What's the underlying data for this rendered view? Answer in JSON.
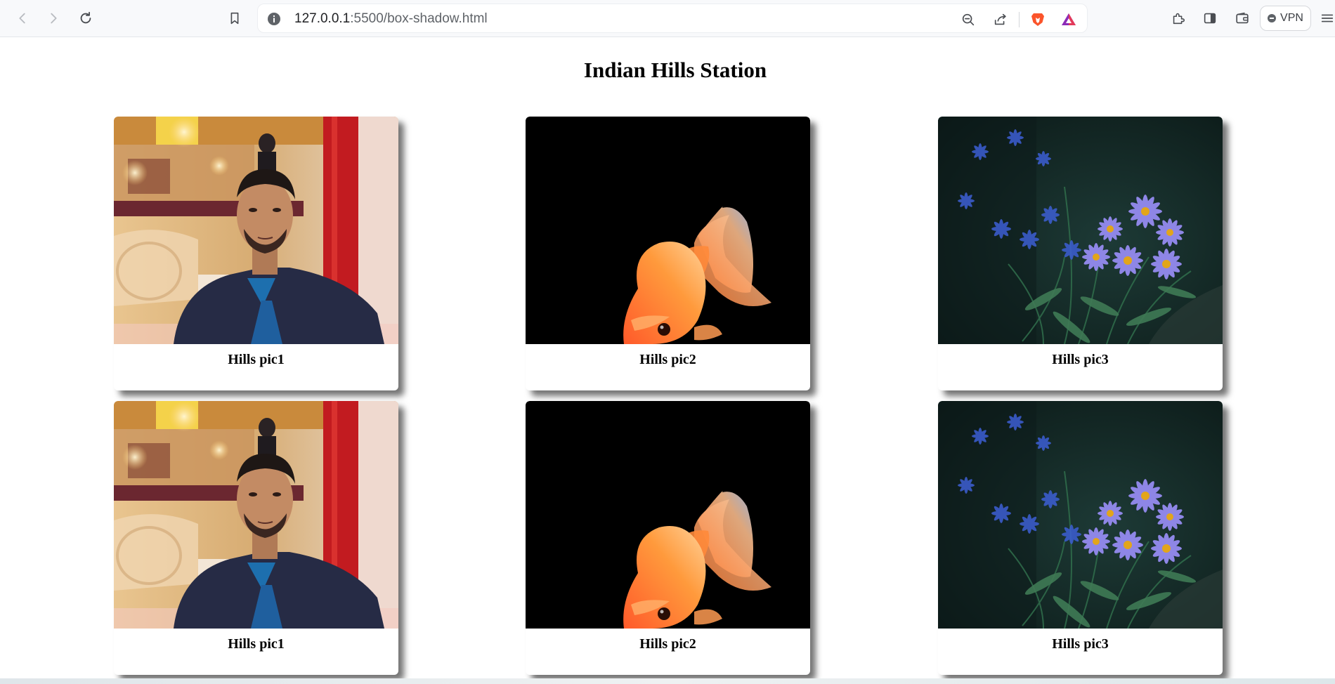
{
  "browser": {
    "url_host": "127.0.0.1",
    "url_path": ":5500/box-shadow.html",
    "vpn_label": "VPN",
    "icons": [
      "back-icon",
      "forward-icon",
      "reload-icon",
      "bookmark-icon",
      "info-icon",
      "zoom-out-icon",
      "share-icon",
      "brave-shields-icon",
      "brave-rewards-icon",
      "extensions-icon",
      "sidebar-icon",
      "wallet-icon",
      "menu-icon"
    ]
  },
  "page": {
    "title": "Indian Hills Station",
    "cards": [
      {
        "caption": "Hills pic1",
        "image": "portrait-photo"
      },
      {
        "caption": "Hills pic2",
        "image": "goldfish-photo"
      },
      {
        "caption": "Hills pic3",
        "image": "flowers-photo"
      },
      {
        "caption": "Hills pic1",
        "image": "portrait-photo"
      },
      {
        "caption": "Hills pic2",
        "image": "goldfish-photo"
      },
      {
        "caption": "Hills pic3",
        "image": "flowers-photo"
      }
    ]
  }
}
